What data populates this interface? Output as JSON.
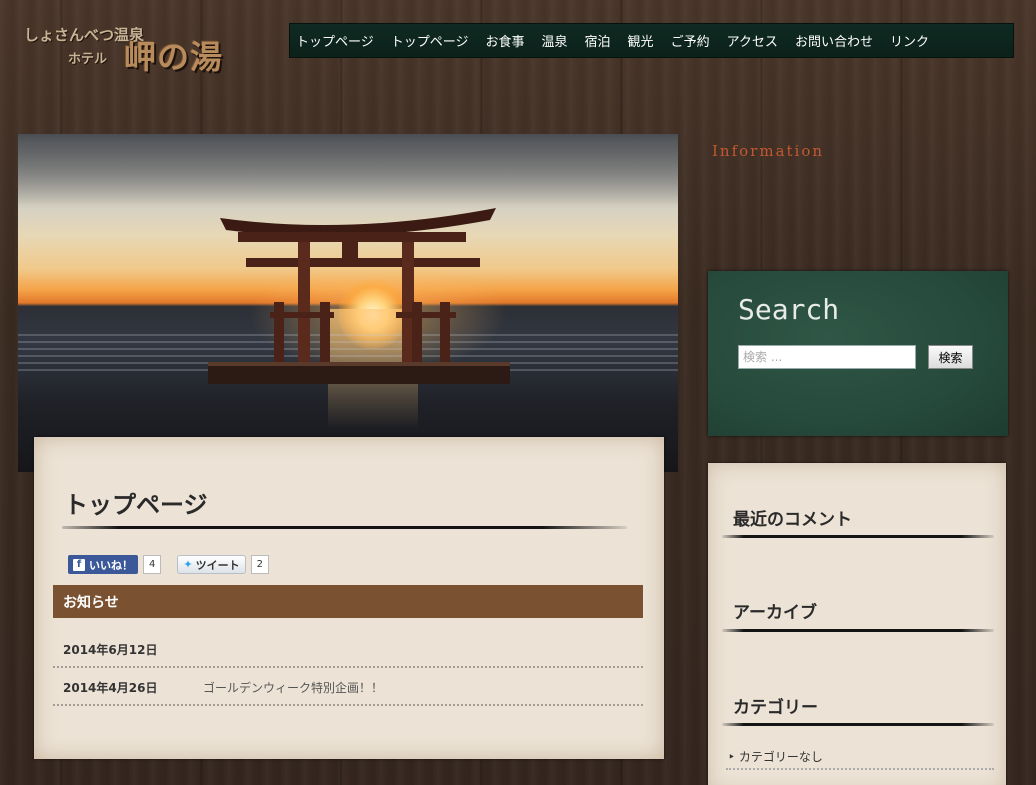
{
  "header": {
    "logo_line1": "しょさんべつ温泉",
    "logo_line2": "ホテル",
    "logo_main": "岬の湯"
  },
  "nav": {
    "items": [
      {
        "label": "トップページ"
      },
      {
        "label": "トップページ"
      },
      {
        "label": "お食事"
      },
      {
        "label": "温泉"
      },
      {
        "label": "宿泊"
      },
      {
        "label": "観光"
      },
      {
        "label": "ご予約"
      },
      {
        "label": "アクセス"
      },
      {
        "label": "お問い合わせ"
      },
      {
        "label": "リンク"
      }
    ]
  },
  "main": {
    "page_title": "トップページ",
    "social": {
      "fb_label": "いいね！",
      "fb_count": "4",
      "tw_label": "ツイート",
      "tw_count": "2"
    },
    "notice_heading": "お知らせ",
    "news": [
      {
        "date": "2014年6月12日",
        "text": ""
      },
      {
        "date": "2014年4月26日",
        "text": "ゴールデンウィーク特別企画！！"
      }
    ]
  },
  "sidebar": {
    "info_heading": "Information",
    "search_title": "Search",
    "search_placeholder": "検索 ...",
    "search_button": "検索",
    "recent_comments": "最近のコメント",
    "archives": "アーカイブ",
    "categories": "カテゴリー",
    "category_item": "カテゴリーなし"
  },
  "colors": {
    "nav_bg": "#0f2a22",
    "notice_bar": "#7a5232",
    "info_heading": "#c1582f",
    "search_bg": "#264a3c",
    "panel_bg": "#ece3d6"
  }
}
